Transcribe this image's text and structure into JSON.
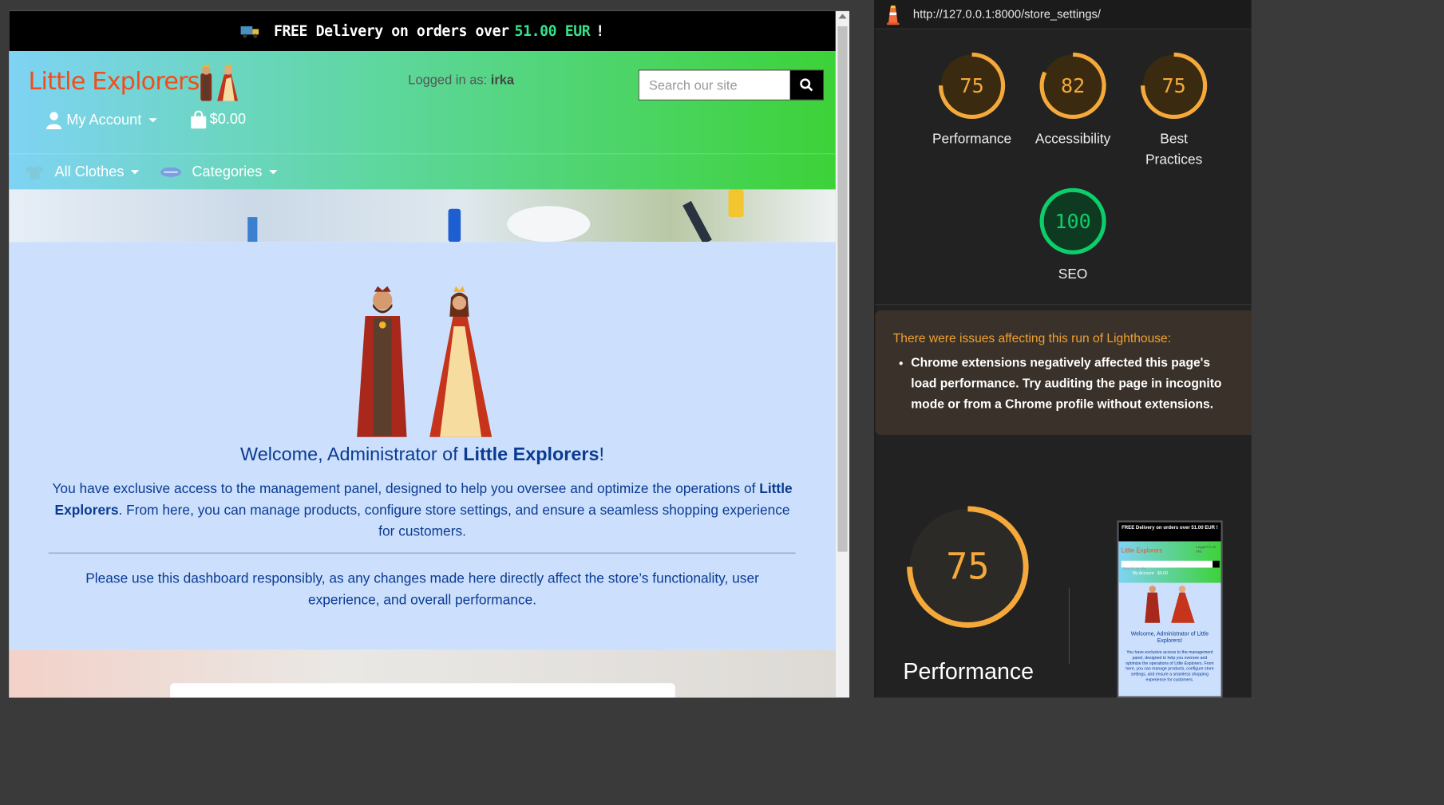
{
  "banner": {
    "text_before": "FREE Delivery on orders over",
    "amount": "51.00 EUR",
    "text_after": "!"
  },
  "header": {
    "logo": "Little Explorers",
    "logged_in_label": "Logged in as:",
    "logged_in_user": "irka",
    "search_placeholder": "Search our site",
    "account_label": "My Account",
    "cart_total": "$0.00"
  },
  "nav": {
    "all_clothes": "All Clothes",
    "categories": "Categories"
  },
  "welcome": {
    "title_prefix": "Welcome, Administrator of ",
    "title_brand": "Little Explorers",
    "title_suffix": "!",
    "p1_start": "You have exclusive access to the management panel, designed to help you oversee and optimize the operations of ",
    "p1_brand": "Little Explorers",
    "p1_end": ". From here, you can manage products, configure store settings, and ensure a seamless shopping experience for customers.",
    "p2": "Please use this dashboard responsibly, as any changes made here directly affect the store’s functionality, user experience, and overall performance."
  },
  "lighthouse": {
    "url": "http://127.0.0.1:8000/store_settings/",
    "scores": [
      {
        "label": "Performance",
        "value": "75",
        "fraction": 0.75,
        "color": "#f4a93a"
      },
      {
        "label": "Accessibility",
        "value": "82",
        "fraction": 0.82,
        "color": "#f4a93a"
      },
      {
        "label": "Best Practices",
        "value": "75",
        "fraction": 0.75,
        "color": "#f4a93a"
      },
      {
        "label": "SEO",
        "value": "100",
        "fraction": 1.0,
        "color": "#0cce6b"
      }
    ],
    "warning_title": "There were issues affecting this run of Lighthouse:",
    "warning_item": "Chrome extensions negatively affected this page's load performance. Try auditing the page in incognito mode or from a Chrome profile without extensions.",
    "big_score": "75",
    "big_fraction": 0.75,
    "big_label": "Performance",
    "thumb": {
      "banner": "FREE Delivery on orders over 51.00 EUR !",
      "logo": "Little Explorers",
      "logged": "Logged in as: irka",
      "search": "Search our site",
      "account": "My Account",
      "cart": "$0.00",
      "welcome": "Welcome, Administrator of Little Explorers!",
      "body": "You have exclusive access to the management panel, designed to help you oversee and optimize the operations of Little Explorers. From here, you can manage products, configure store settings, and ensure a seamless shopping experience for customers."
    }
  },
  "colors": {
    "accent_orange": "#f04e1c",
    "welcome_text": "#0a3a91",
    "welcome_bg": "#cce0fd",
    "gauge_orange": "#f4a93a",
    "gauge_green": "#0cce6b"
  }
}
